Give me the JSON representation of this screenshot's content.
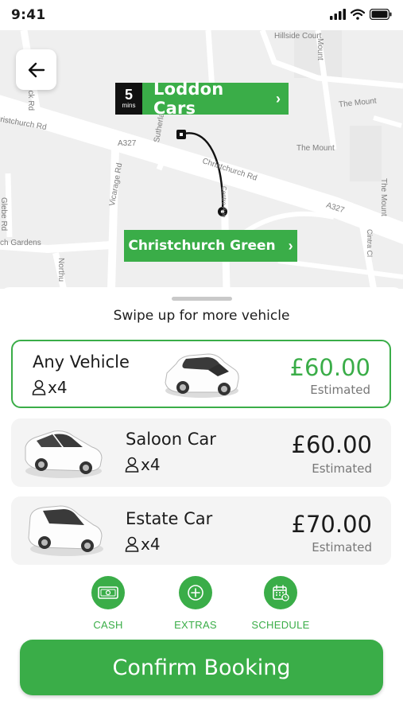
{
  "status_bar": {
    "time": "9:41"
  },
  "map": {
    "labels": {
      "hillside_court": "Hillside Court",
      "mount_top": "Mount",
      "the_mount_1": "The Mount",
      "the_mount_2": "The Mount",
      "the_mount_3": "The Mount",
      "brick_rd": "rick Rd",
      "christchurch_rd_left": "ristchurch Rd",
      "a327_1": "A327",
      "a327_2": "A327",
      "christchurch_rd_mid": "Christchurch Rd",
      "sutherland": "Sutherla",
      "vicarage_rd": "Vicarage Rd",
      "centre_ave": "Centre Ave",
      "glebe_rd": "Glebe Rd",
      "gardens": "ch Gardens",
      "northumberland": "Northu",
      "cintra_cl": "Cintra Cl"
    },
    "pickup": {
      "eta_value": "5",
      "eta_unit": "mins",
      "name": "Loddon Cars"
    },
    "destination": {
      "name": "Christchurch Green"
    }
  },
  "sheet": {
    "hint": "Swipe up for more vehicle",
    "vehicles": [
      {
        "name": "Any Vehicle",
        "seats": "x4",
        "price": "£60.00",
        "note": "Estimated",
        "selected": true
      },
      {
        "name": "Saloon Car",
        "seats": "x4",
        "price": "£60.00",
        "note": "Estimated",
        "selected": false
      },
      {
        "name": "Estate Car",
        "seats": "x4",
        "price": "£70.00",
        "note": "Estimated",
        "selected": false
      }
    ],
    "options": [
      {
        "label": "CASH",
        "icon": "cash-icon"
      },
      {
        "label": "EXTRAS",
        "icon": "plus-circle-icon"
      },
      {
        "label": "SCHEDULE",
        "icon": "calendar-icon"
      }
    ],
    "confirm_label": "Confirm Booking"
  },
  "colors": {
    "accent": "#3aad48",
    "eta_box": "#111111",
    "map_bg": "#efefef"
  }
}
